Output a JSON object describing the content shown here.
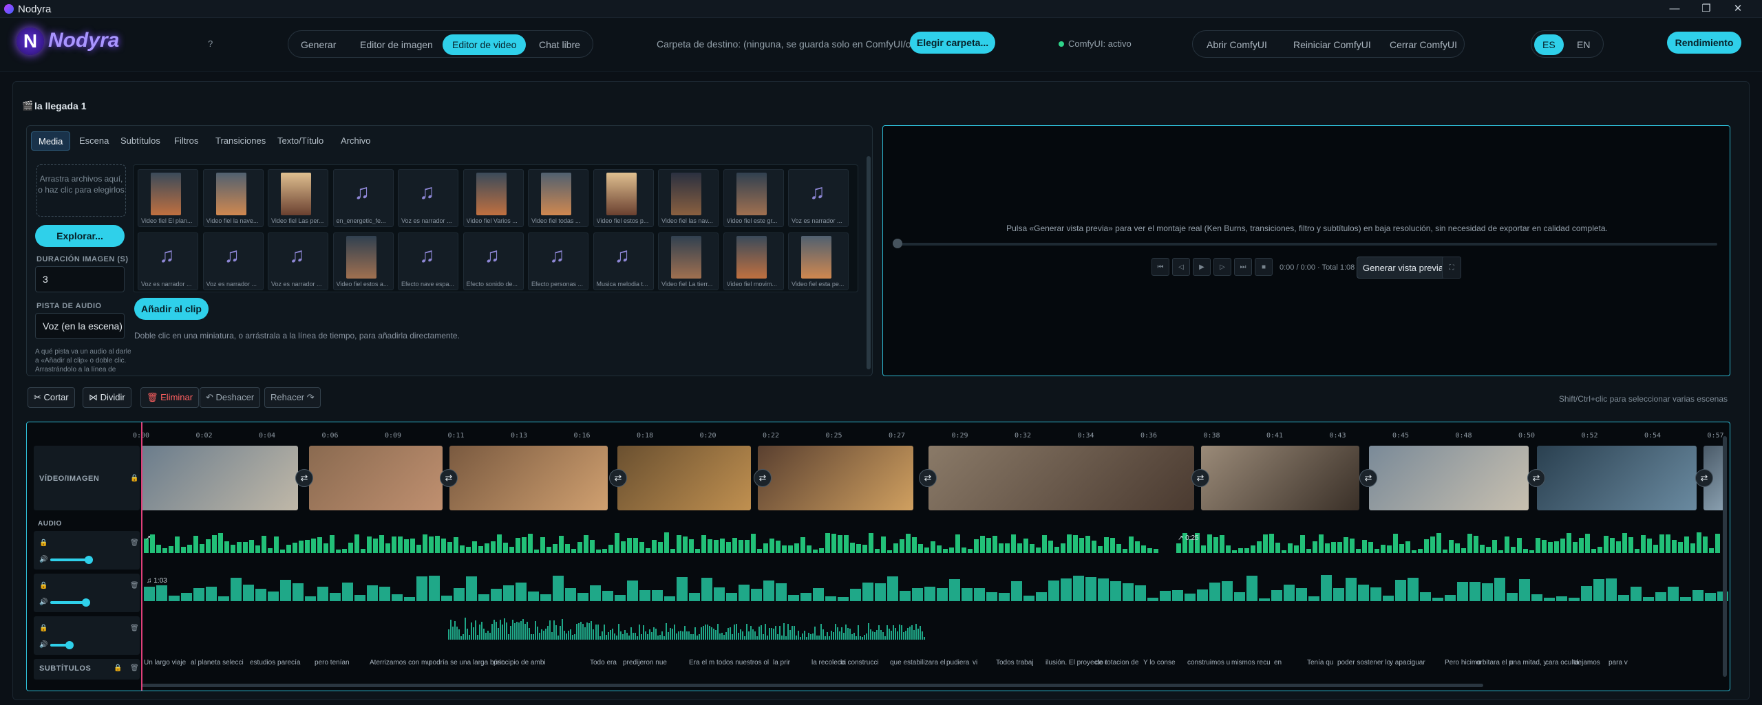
{
  "window": {
    "title": "Nodyra",
    "min": "—",
    "max": "❐",
    "close": "✕"
  },
  "brand": {
    "name": "Nodyra",
    "logo_letter": "N"
  },
  "help_label": "?",
  "modes": [
    "Generar",
    "Editor de imagen",
    "Editor de video",
    "Chat libre"
  ],
  "active_mode": "Editor de video",
  "destination": {
    "text": "Carpeta de destino: (ninguna, se guarda solo en ComfyUI/output)",
    "button": "Elegir carpeta..."
  },
  "comfy": {
    "status": "ComfyUI: activo",
    "open": "Abrir ComfyUI",
    "restart": "Reiniciar ComfyUI",
    "close": "Cerrar ComfyUI"
  },
  "lang": {
    "es": "ES",
    "en": "EN",
    "active": "ES"
  },
  "performance_label": "Rendimiento",
  "project": {
    "name": "la llegada 1"
  },
  "tabs": [
    "Media",
    "Escena",
    "Subtítulos",
    "Filtros",
    "Transiciones",
    "Texto/Título",
    "Archivo"
  ],
  "active_tab": "Media",
  "media": {
    "drop_text": "Arrastra archivos aquí, o haz clic para elegirlos",
    "browse_button": "Explorar...",
    "duration_label": "DURACIÓN IMAGEN (S)",
    "duration_value": "3",
    "audio_track_label": "PISTA DE AUDIO",
    "audio_track_value": "Voz (en la escena)",
    "audio_hint": "A qué pista va un audio al darle a «Añadir al clip» o doble clic. Arrastrándolo a la línea de tiempo puedes",
    "add_button": "Añadir al clip",
    "dbl_hint": "Doble clic en una miniatura, o arrástrala a la línea de tiempo, para añadirla directamente.",
    "items": [
      {
        "type": "video",
        "caption": "Video fiel El plan..."
      },
      {
        "type": "video",
        "caption": "Video fiel la nave..."
      },
      {
        "type": "video",
        "caption": "Video fiel Las per..."
      },
      {
        "type": "audio",
        "caption": "en_energetic_fe..."
      },
      {
        "type": "audio",
        "caption": "Voz es narrador ..."
      },
      {
        "type": "video",
        "caption": "Video fiel Varios ..."
      },
      {
        "type": "video",
        "caption": "Video fiel todas ..."
      },
      {
        "type": "video",
        "caption": "Video fiel estos p..."
      },
      {
        "type": "video",
        "caption": "Video fiel las nav..."
      },
      {
        "type": "video",
        "caption": "Video fiel este gr..."
      },
      {
        "type": "audio",
        "caption": "Voz es narrador ..."
      },
      {
        "type": "audio",
        "caption": "Voz es narrador ..."
      },
      {
        "type": "audio",
        "caption": "Voz es narrador ..."
      },
      {
        "type": "audio",
        "caption": "Voz es narrador ..."
      },
      {
        "type": "video",
        "caption": "Video fiel estos a..."
      },
      {
        "type": "audio",
        "caption": "Efecto nave espa..."
      },
      {
        "type": "audio",
        "caption": "Efecto sonido de..."
      },
      {
        "type": "audio",
        "caption": "Efecto personas ..."
      },
      {
        "type": "audio",
        "caption": "Musica melodia t..."
      },
      {
        "type": "video",
        "caption": "Video fiel La tierr..."
      },
      {
        "type": "video",
        "caption": "Video fiel movim..."
      },
      {
        "type": "video",
        "caption": "Video fiel esta pe..."
      }
    ]
  },
  "preview": {
    "message": "Pulsa «Generar vista previa» para ver el montaje real (Ken Burns, transiciones, filtro y subtítulos) en baja resolución, sin necesidad de exportar en calidad completa.",
    "timecode": "0:00 / 0:00 · Total 1:08",
    "generate_button": "Generar vista previa",
    "controls": [
      "⏮",
      "◁",
      "▶",
      "▷",
      "⏭",
      "■"
    ]
  },
  "toolbar": {
    "cut": "✂ Cortar",
    "split": "⋈ Dividir",
    "delete": "🗑 Eliminar",
    "undo": "↶ Deshacer",
    "redo": "Rehacer ↷",
    "hint": "Shift/Ctrl+clic para seleccionar varias escenas"
  },
  "timeline": {
    "ticks": [
      "0:00",
      "0:02",
      "0:04",
      "0:06",
      "0:09",
      "0:11",
      "0:13",
      "0:16",
      "0:18",
      "0:20",
      "0:22",
      "0:25",
      "0:27",
      "0:29",
      "0:32",
      "0:34",
      "0:36",
      "0:38",
      "0:41",
      "0:43",
      "0:45",
      "0:48",
      "0:50",
      "0:52",
      "0:54",
      "0:57"
    ],
    "video_label": "VÍDEO/IMAGEN",
    "audio_label": "AUDIO",
    "subs_label": "SUBTÍTULOS",
    "music_time": "♫ 1:03",
    "marker1": "↗",
    "marker2": "↗ 0:25",
    "subtitles": [
      "Un largo viaje",
      "al planeta selecci",
      "estudios parecía",
      "pero tenían",
      "Aterrizamos con mu",
      "podría se una larga búsc",
      "principio de ambi",
      "Todo era",
      "predijeron nue",
      "Era el m",
      "todos nuestros ol",
      "la prir",
      "la recolecci",
      "la construcci",
      "que estabilizara el",
      "pudiera",
      "vi",
      "Todos trabaj",
      "ilusión. El proyecto t",
      "de rotacion de",
      "Y lo conse",
      "construimos u",
      "mismos recu",
      "en",
      "Tenía qu",
      "poder sostener lo",
      "y apaciguar",
      "Pero hicimo",
      "orbitara el p",
      "una mitad, y",
      "cara oculta",
      "dejamos",
      "para v"
    ]
  },
  "colors": {
    "accent": "#2fd0ea",
    "wave": "#22c078",
    "playhead": "#e0407a",
    "delete": "#ff6060"
  }
}
